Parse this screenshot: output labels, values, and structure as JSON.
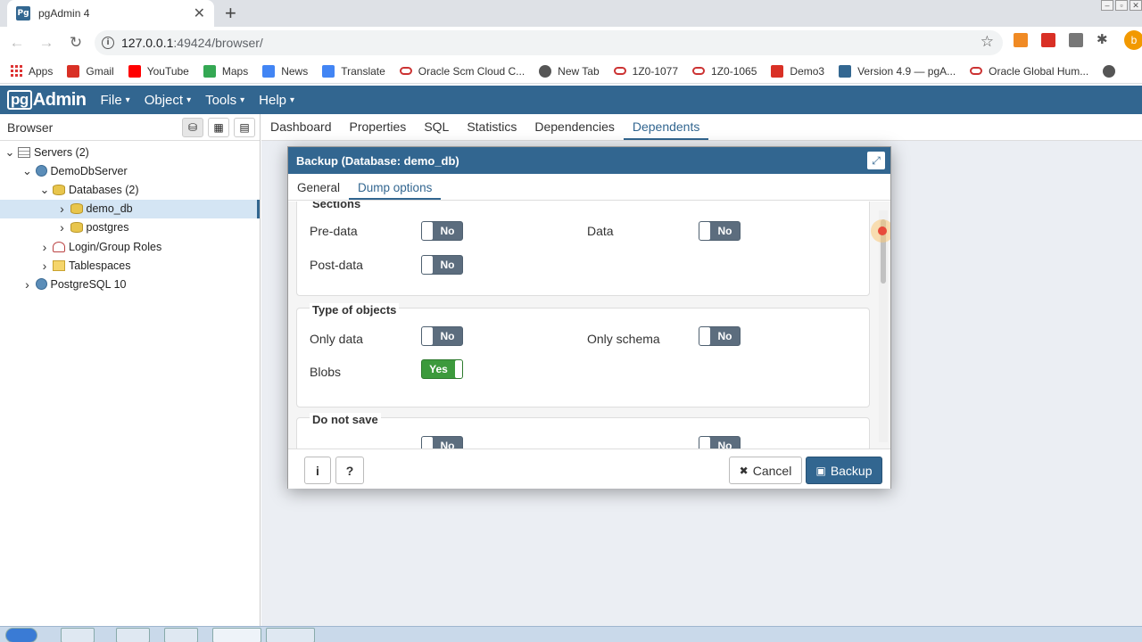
{
  "browser": {
    "tab_title": "pgAdmin 4",
    "url_host": "127.0.0.1",
    "url_path": ":49424/browser/",
    "avatar_letter": "b",
    "bookmarks": [
      {
        "label": "Apps",
        "icon": "apps-grid-icon"
      },
      {
        "label": "Gmail",
        "icon": "gmail-icon"
      },
      {
        "label": "YouTube",
        "icon": "youtube-icon"
      },
      {
        "label": "Maps",
        "icon": "maps-icon"
      },
      {
        "label": "News",
        "icon": "news-icon"
      },
      {
        "label": "Translate",
        "icon": "translate-icon"
      },
      {
        "label": "Oracle Scm Cloud C...",
        "icon": "oracle-icon"
      },
      {
        "label": "New Tab",
        "icon": "globe-icon"
      },
      {
        "label": "1Z0-1077",
        "icon": "oracle-icon"
      },
      {
        "label": "1Z0-1065",
        "icon": "oracle-icon"
      },
      {
        "label": "Demo3",
        "icon": "demo-icon"
      },
      {
        "label": "Version 4.9 — pgA...",
        "icon": "pgadmin-icon"
      },
      {
        "label": "Oracle Global Hum...",
        "icon": "oracle-icon"
      }
    ]
  },
  "app": {
    "logo": {
      "box": "pg",
      "rest": "Admin"
    },
    "menu": [
      "File",
      "Object",
      "Tools",
      "Help"
    ]
  },
  "browser_panel": {
    "title": "Browser",
    "tree": [
      {
        "label": "Servers (2)",
        "level": 0,
        "twisty": "v",
        "icon": "servers"
      },
      {
        "label": "DemoDbServer",
        "level": 1,
        "twisty": "v",
        "icon": "server"
      },
      {
        "label": "Databases (2)",
        "level": 2,
        "twisty": "v",
        "icon": "db"
      },
      {
        "label": "demo_db",
        "level": 3,
        "twisty": ">",
        "icon": "db",
        "selected": true
      },
      {
        "label": "postgres",
        "level": 3,
        "twisty": ">",
        "icon": "db"
      },
      {
        "label": "Login/Group Roles",
        "level": 2,
        "twisty": ">",
        "icon": "roles"
      },
      {
        "label": "Tablespaces",
        "level": 2,
        "twisty": ">",
        "icon": "tbs"
      },
      {
        "label": "PostgreSQL 10",
        "level": 1,
        "twisty": ">",
        "icon": "server"
      }
    ]
  },
  "main_tabs": [
    "Dashboard",
    "Properties",
    "SQL",
    "Statistics",
    "Dependencies",
    "Dependents"
  ],
  "main_active_tab": "Dependents",
  "dialog": {
    "title": "Backup (Database: demo_db)",
    "tabs": [
      "General",
      "Dump options"
    ],
    "active_tab": "Dump options",
    "sections": {
      "title": "Sections",
      "pre_data": {
        "label": "Pre-data",
        "value": "No"
      },
      "data": {
        "label": "Data",
        "value": "No"
      },
      "post_data": {
        "label": "Post-data",
        "value": "No"
      }
    },
    "type_of_objects": {
      "title": "Type of objects",
      "only_data": {
        "label": "Only data",
        "value": "No"
      },
      "only_schema": {
        "label": "Only schema",
        "value": "No"
      },
      "blobs": {
        "label": "Blobs",
        "value": "Yes"
      }
    },
    "do_not_save": {
      "title": "Do not save",
      "first": {
        "value": "No"
      },
      "second": {
        "value": "No"
      }
    },
    "info_label": "i",
    "help_label": "?",
    "cancel_label": "Cancel",
    "backup_label": "Backup"
  }
}
